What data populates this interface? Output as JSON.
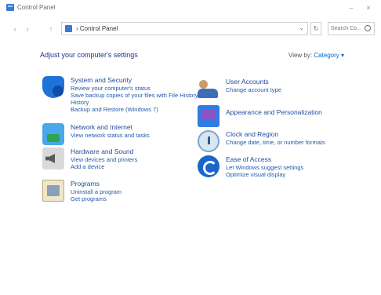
{
  "window": {
    "title": "Control Panel",
    "minimize_glyph": "–",
    "close_glyph": "×"
  },
  "address": {
    "back_glyph": "‹",
    "forward_glyph": "›",
    "up_glyph": "↑",
    "breadcrumb": "›  Control Panel",
    "dropdown_glyph": "⌄",
    "refresh_glyph": "↻",
    "search_placeholder": "Search Co..."
  },
  "header": {
    "heading": "Adjust your computer's settings",
    "view_by_label": "View by: ",
    "view_by_value": "Category ▾"
  },
  "categories_left": [
    {
      "title": "System and Security",
      "icon": "shield-icon",
      "links": [
        "Review your computer's status",
        "Save backup copies of your files with File History",
        "History",
        "Backup and Restore (Windows 7)"
      ]
    },
    {
      "title": "Network and Internet",
      "icon": "network-globe-icon",
      "links": [
        "View network status and tasks"
      ]
    },
    {
      "title": "Hardware and Sound",
      "icon": "speaker-icon",
      "links": [
        "View devices and printers",
        "Add a device"
      ]
    },
    {
      "title": "Programs",
      "icon": "programs-icon",
      "links": [
        "Uninstall a program",
        "Get programs"
      ]
    }
  ],
  "categories_right": [
    {
      "title": "User Accounts",
      "icon": "user-accounts-icon",
      "links": [
        "Change account type"
      ]
    },
    {
      "title": "Appearance and Personalization",
      "icon": "appearance-icon",
      "links": []
    },
    {
      "title": "Clock and Region",
      "icon": "clock-region-icon",
      "links": [
        "Change date, time, or number formats"
      ]
    },
    {
      "title": "Ease of Access",
      "icon": "ease-of-access-icon",
      "links": [
        "Let Windows suggest settings",
        "Optimize visual display"
      ]
    }
  ]
}
